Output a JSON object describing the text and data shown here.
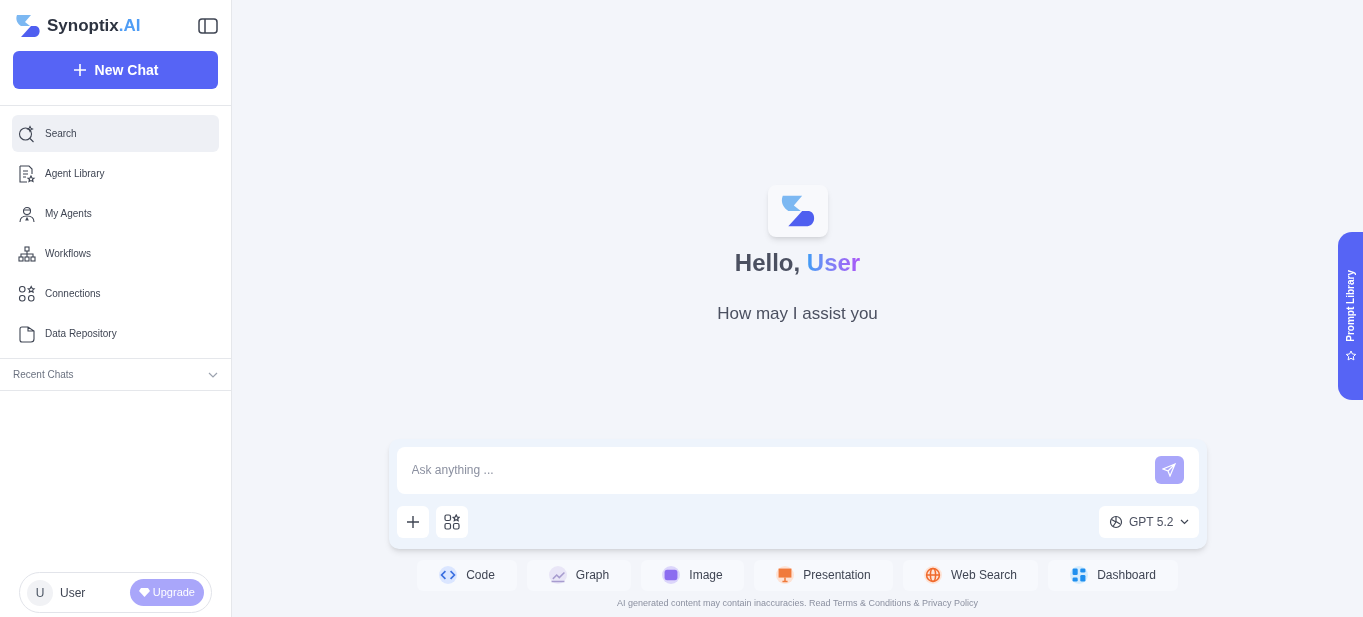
{
  "sidebar": {
    "brand": {
      "name": "Synoptix",
      "suffix": ".AI"
    },
    "new_chat": "New Chat",
    "items": [
      {
        "label": "Search",
        "kind": "search",
        "selected": true
      },
      {
        "label": "Agent Library",
        "kind": "library",
        "selected": false
      },
      {
        "label": "My Agents",
        "kind": "agent",
        "selected": false
      },
      {
        "label": "Workflows",
        "kind": "workflow",
        "selected": false
      },
      {
        "label": "Connections",
        "kind": "connections",
        "selected": false
      },
      {
        "label": "Data Repository",
        "kind": "folder",
        "selected": false
      }
    ],
    "recent_chats": {
      "label": "Recent Chats",
      "expanded": false
    },
    "user": {
      "initial": "U",
      "name": "User",
      "upgrade": "Upgrade"
    }
  },
  "main": {
    "greeting": "Hello,",
    "greeting_name": "User",
    "subtitle": "How may I assist you",
    "composer": {
      "placeholder": "Ask anything ...",
      "model": "GPT 5.2"
    },
    "quick_actions": [
      {
        "label": "Code",
        "kind": "code"
      },
      {
        "label": "Graph",
        "kind": "graph"
      },
      {
        "label": "Image",
        "kind": "image"
      },
      {
        "label": "Presentation",
        "kind": "presentation"
      },
      {
        "label": "Web Search",
        "kind": "web"
      },
      {
        "label": "Dashboard",
        "kind": "dashboard"
      }
    ],
    "disclaimer": "AI generated content may contain inaccuracies. Read Terms & Conditions & Privacy Policy"
  },
  "prompt_library_tab": "Prompt Library"
}
